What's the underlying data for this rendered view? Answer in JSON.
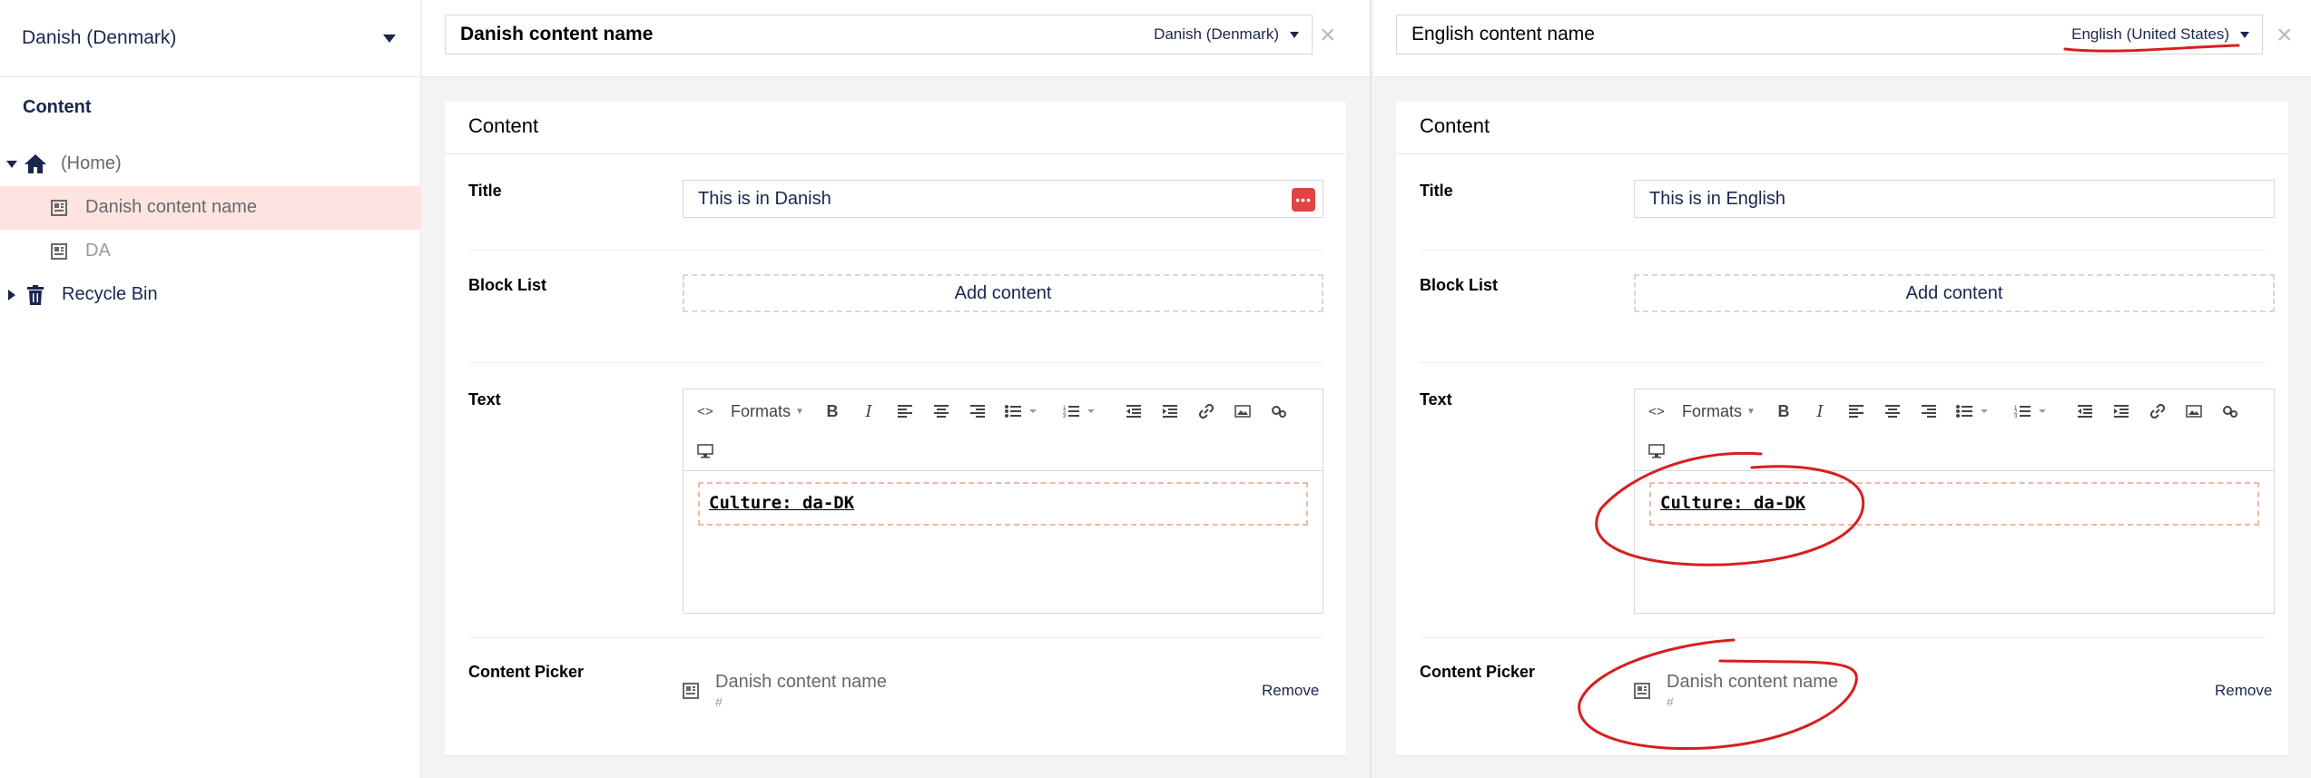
{
  "sidebar": {
    "culture": "Danish (Denmark)",
    "section_title": "Content",
    "tree": [
      {
        "label": "(Home)",
        "icon": "home-icon"
      },
      {
        "label": "Danish content name",
        "icon": "document-icon"
      },
      {
        "label": "DA",
        "icon": "document-icon"
      },
      {
        "label": "Recycle Bin",
        "icon": "trash-icon"
      }
    ]
  },
  "left": {
    "name": "Danish content name",
    "variant": "Danish (Denmark)",
    "card_title": "Content",
    "title_label": "Title",
    "title_value": "This is in Danish",
    "blocklist_label": "Block List",
    "add_content": "Add content",
    "text_label": "Text",
    "formats": "Formats",
    "rte_content": "Culture: da-DK",
    "picker_label": "Content Picker",
    "picker_name": "Danish content name",
    "picker_url": "#",
    "remove": "Remove"
  },
  "right": {
    "name": "English content name",
    "variant": "English (United States)",
    "card_title": "Content",
    "title_label": "Title",
    "title_value": "This is in English",
    "blocklist_label": "Block List",
    "add_content": "Add content",
    "text_label": "Text",
    "formats": "Formats",
    "rte_content": "Culture: da-DK",
    "picker_label": "Content Picker",
    "picker_name": "Danish content name",
    "picker_url": "#",
    "remove": "Remove"
  },
  "colors": {
    "navy": "#1b264f",
    "highlight": "#fde4e0",
    "annotation": "#d81e1e"
  }
}
